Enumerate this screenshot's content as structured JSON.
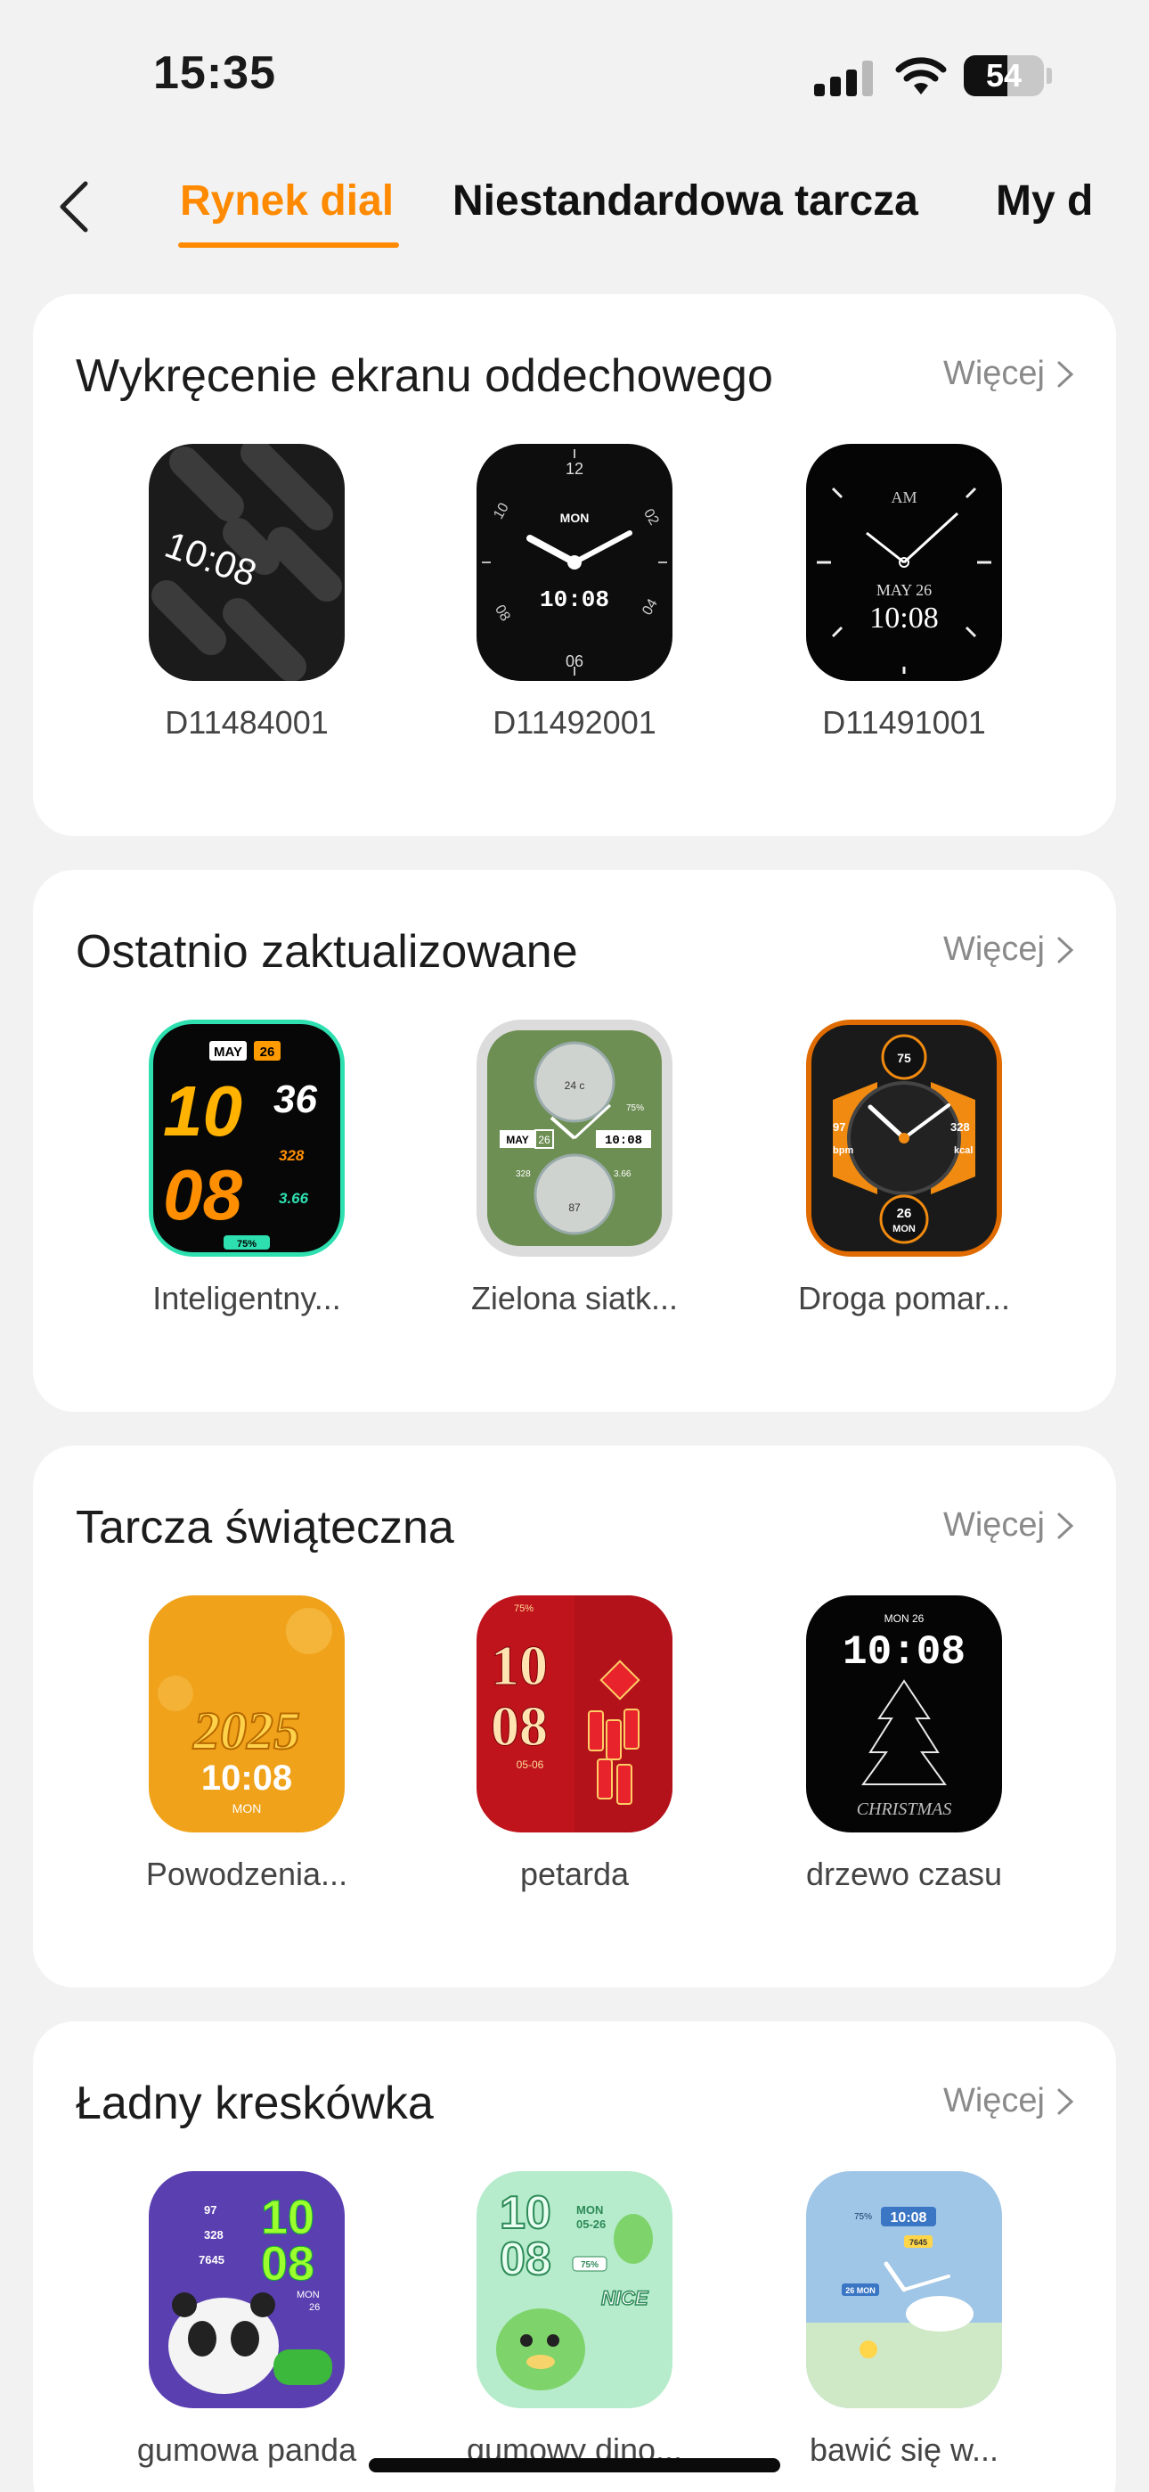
{
  "status_bar": {
    "time": "15:35",
    "battery": "54"
  },
  "nav": {
    "tabs": [
      {
        "label": "Rynek dial",
        "active": true
      },
      {
        "label": "Niestandardowa tarcza",
        "active": false
      },
      {
        "label": "My d",
        "active": false
      }
    ]
  },
  "sections": [
    {
      "title": "Wykręcenie ekranu oddechowego",
      "more": "Więcej",
      "dials": [
        {
          "name": "D11484001",
          "time": "10:08"
        },
        {
          "name": "D11492001",
          "time": "10:08",
          "day": "MON",
          "top": "12",
          "bottom": "06",
          "left_top": "10",
          "right_top": "02",
          "left_bottom": "08",
          "right_bottom": "04"
        },
        {
          "name": "D11491001",
          "time": "10:08",
          "date": "MAY 26",
          "ampm": "AM"
        }
      ]
    },
    {
      "title": "Ostatnio zaktualizowane",
      "more": "Więcej",
      "dials": [
        {
          "name": "Inteligentny...",
          "hour": "10",
          "minute": "08",
          "seconds": "36",
          "month": "MAY",
          "day": "26",
          "stat1": "328",
          "stat2": "3.66",
          "battery": "75%"
        },
        {
          "name": "Zielona siatk...",
          "time": "10:08",
          "month": "MAY",
          "day": "26",
          "temp": "24 c",
          "stat1": "328",
          "stat2": "3.66",
          "bpm": "87",
          "battery": "75%"
        },
        {
          "name": "Droga pomar...",
          "top": "75",
          "left": "97",
          "right": "328",
          "left_label": "bpm",
          "right_label": "kcal",
          "day": "26",
          "weekday": "MON"
        }
      ]
    },
    {
      "title": "Tarcza świąteczna",
      "more": "Więcej",
      "dials": [
        {
          "name": "Powodzenia...",
          "year": "2025",
          "time": "10:08",
          "weekday": "MON"
        },
        {
          "name": "petarda",
          "hour": "10",
          "minute": "08",
          "date": "05-06",
          "battery": "75%"
        },
        {
          "name": "drzewo czasu",
          "date": "MON 26",
          "time": "10:08",
          "caption": "CHRISTMAS"
        }
      ]
    },
    {
      "title": "Ładny kreskówka",
      "more": "Więcej",
      "dials": [
        {
          "name": "gumowa panda",
          "hour": "10",
          "minute": "08",
          "heart": "97",
          "stat1": "328",
          "steps": "7645",
          "weekday": "MON",
          "day": "26"
        },
        {
          "name": "gumowy dino...",
          "hour": "10",
          "minute": "08",
          "weekday": "MON",
          "date": "05-26",
          "battery": "75%",
          "caption": "NICE"
        },
        {
          "name": "bawić się w...",
          "time": "10:08",
          "battery": "75%",
          "steps": "7645",
          "date": "26 MON"
        }
      ]
    }
  ],
  "colors": {
    "accent": "#ff8a00",
    "background": "#f2f2f3",
    "card": "#ffffff",
    "more_text": "#8a8a8a"
  },
  "icons": [
    "back-chevron-icon",
    "chevron-right-icon",
    "signal-icon",
    "wifi-icon",
    "battery-icon"
  ]
}
